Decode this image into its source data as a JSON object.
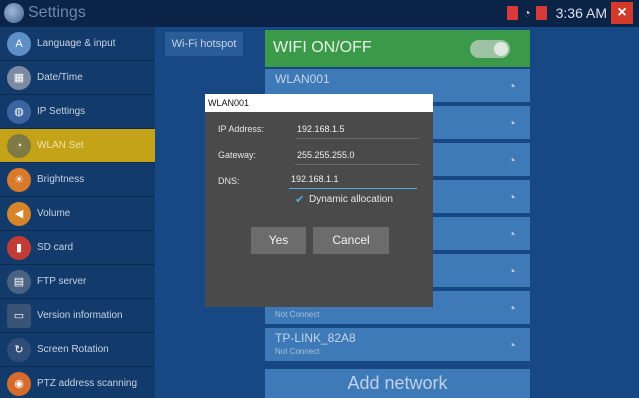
{
  "app": {
    "title": "Settings",
    "icon": "settings-gear-icon"
  },
  "status": {
    "time": "3:36 AM",
    "icons": [
      "battery-red-icon",
      "wifi-icon",
      "battery-icon"
    ],
    "close_glyph": "×"
  },
  "sidebar": {
    "items": [
      {
        "label": "Language & input",
        "icon": "globe-language-icon",
        "color": "#5e8fc7"
      },
      {
        "label": "Date/Time",
        "icon": "calendar-icon",
        "color": "#7c8aa3"
      },
      {
        "label": "IP Settings",
        "icon": "globe-icon",
        "color": "#3c64a0"
      },
      {
        "label": "WLAN Set",
        "icon": "wifi-icon",
        "color": "#7e7a42",
        "active": true
      },
      {
        "label": "Brightness",
        "icon": "sun-icon",
        "color": "#d77a2c"
      },
      {
        "label": "Volume",
        "icon": "speaker-icon",
        "color": "#d5842a"
      },
      {
        "label": "SD card",
        "icon": "sd-card-icon",
        "color": "#c13c35"
      },
      {
        "label": "FTP server",
        "icon": "ftp-server-icon",
        "color": "#4a6282"
      },
      {
        "label": "Version information",
        "icon": "info-card-icon",
        "color": "#3a5478"
      },
      {
        "label": "Screen Rotation",
        "icon": "rotate-icon",
        "color": "#2f4d78"
      },
      {
        "label": "PTZ address scanning",
        "icon": "ptz-scan-icon",
        "color": "#d76b2c"
      }
    ]
  },
  "main": {
    "hotspot_tab": "Wi-Fi hotspot",
    "wifi_toggle": {
      "label": "WIFI ON/OFF",
      "on": true
    },
    "networks": [
      {
        "name": "WLAN001",
        "status": ""
      },
      {
        "name": "",
        "status": ""
      },
      {
        "name": "",
        "status": ""
      },
      {
        "name": "",
        "status": ""
      },
      {
        "name": "",
        "status": ""
      },
      {
        "name": "",
        "status": ""
      },
      {
        "name": "",
        "status": "Not Connect"
      },
      {
        "name": "TP-LINK_82A8",
        "status": "Not Connect"
      }
    ],
    "add_network": "Add network"
  },
  "dialog": {
    "title": "WLAN001",
    "ip_label": "IP Address:",
    "ip_value": "192.168.1.5",
    "gateway_label": "Gateway:",
    "gateway_value": "255.255.255.0",
    "dns_label": "DNS:",
    "dns_value": "192.168.1.1",
    "dynamic_label": "Dynamic allocation",
    "dynamic_checked": true,
    "yes_label": "Yes",
    "cancel_label": "Cancel"
  }
}
